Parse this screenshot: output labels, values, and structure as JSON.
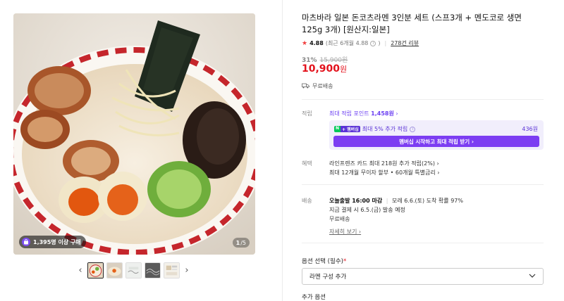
{
  "gallery": {
    "buyer_badge": "1,395명 이상 구매",
    "page_current": "1",
    "page_total": "/5",
    "thumbnails": [
      "ramen-bowl",
      "ramen-closeup",
      "noodle-pack",
      "noodle-dark",
      "package-info"
    ]
  },
  "product": {
    "title": "마츠바라 일본 돈코츠라멘 3인분 세트 (스프3개 + 멘도코로 생면125g 3개) [원산지:일본]",
    "rating": "4.88",
    "rating_sub": "(최근 6개월 4.88",
    "rating_sub_end": ")",
    "reviews": "278건 리뷰",
    "discount": "31%",
    "original_price": "15,900원",
    "final_price": "10,900",
    "currency": "원",
    "shipping": "무료배송"
  },
  "points": {
    "label": "적립",
    "max_points_text": "최대 적립 포인트",
    "max_points_value": "1,458원",
    "npay_n": "N",
    "npay_plus": "+ 멤버십",
    "extra_text": "최대 5% 추가 적립",
    "extra_amount": "436원",
    "cta": "멤버십 시작하고 최대 적립 받기"
  },
  "benefits": {
    "label": "혜택",
    "line1": "라인프렌즈 카드 최대 218원 추가 적립(2%)",
    "line2": "최대 12개월 무이자 할부 • 60개월 특별금리"
  },
  "delivery": {
    "label": "배송",
    "deadline": "오늘출발 16:00 마감",
    "eta": "모레 6.6.(토) 도착 확률 97%",
    "dispatch": "지금 결제 시 6.5.(금) 발송 예정",
    "fee": "무료배송",
    "detail_link": "자세히 보기"
  },
  "options": {
    "label": "옵션 선택 (필수)",
    "required_mark": "*",
    "selected": "라멘 구성 추가",
    "add_label": "추가 옵션"
  },
  "colors": {
    "price_red": "#e3121c",
    "purple": "#6b3ff2",
    "star": "#f13f3f"
  }
}
